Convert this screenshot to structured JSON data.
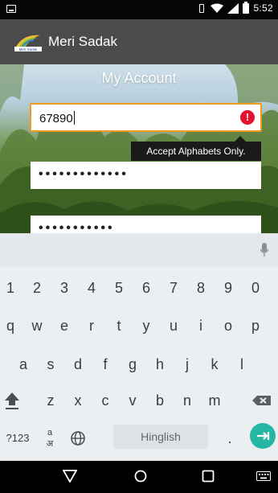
{
  "status_bar": {
    "time": "5:52"
  },
  "app_bar": {
    "title": "Meri Sadak",
    "logo_text": "Meri Sadak"
  },
  "page": {
    "heading": "My Account"
  },
  "form": {
    "field1": {
      "value": "67890",
      "error_icon_text": "!"
    },
    "tooltip": "Accept Alphabets Only.",
    "field2": {
      "masked_value": "•••••••••••••"
    },
    "field3": {
      "masked_value": "•••••••••••"
    }
  },
  "keyboard": {
    "row1": [
      "1",
      "2",
      "3",
      "4",
      "5",
      "6",
      "7",
      "8",
      "9",
      "0"
    ],
    "row2": [
      "q",
      "w",
      "e",
      "r",
      "t",
      "y",
      "u",
      "i",
      "o",
      "p"
    ],
    "row3": [
      "a",
      "s",
      "d",
      "f",
      "g",
      "h",
      "j",
      "k",
      "l"
    ],
    "row4": [
      "z",
      "x",
      "c",
      "v",
      "b",
      "n",
      "m"
    ],
    "symbols_label": "?123",
    "lang_key_label": "अ",
    "lang_key_top": "a",
    "space_label": "Hinglish",
    "period": "."
  },
  "colors": {
    "accent_orange": "#f39a1e",
    "error_red": "#e8112d",
    "enter_teal": "#26b7a4",
    "appbar": "#4b4b4b"
  },
  "icons": [
    "mic-icon",
    "shift-icon",
    "backspace-icon",
    "globe-icon",
    "enter-icon",
    "back-nav-icon",
    "home-nav-icon",
    "recents-nav-icon",
    "keyboard-switch-icon"
  ]
}
